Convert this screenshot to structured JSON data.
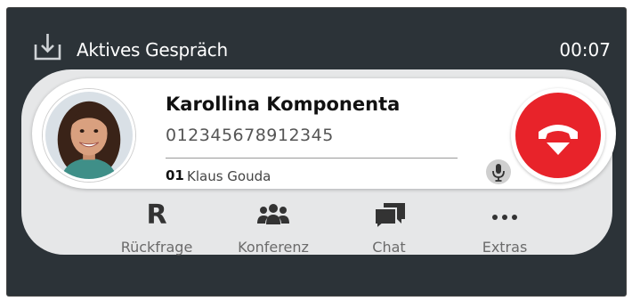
{
  "header": {
    "title": "Aktives Gespräch",
    "timer": "00:07",
    "icon": "download-tray-icon"
  },
  "call": {
    "contact_name": "Karollina Komponenta",
    "phone_number": "012345678912345",
    "line_number": "01",
    "line_user": "Klaus Gouda",
    "mic_icon": "microphone-icon",
    "hangup_icon": "hang-up-icon",
    "hangup_color": "#e8232a"
  },
  "actions": [
    {
      "label": "Rückfrage",
      "icon": "R"
    },
    {
      "label": "Konferenz",
      "icon": "group-icon"
    },
    {
      "label": "Chat",
      "icon": "chat-bubbles-icon"
    },
    {
      "label": "Extras",
      "icon": "more-dots-icon"
    }
  ],
  "colors": {
    "background": "#2c3338",
    "panel": "#e6e7e8",
    "accent_red": "#e8232a"
  }
}
